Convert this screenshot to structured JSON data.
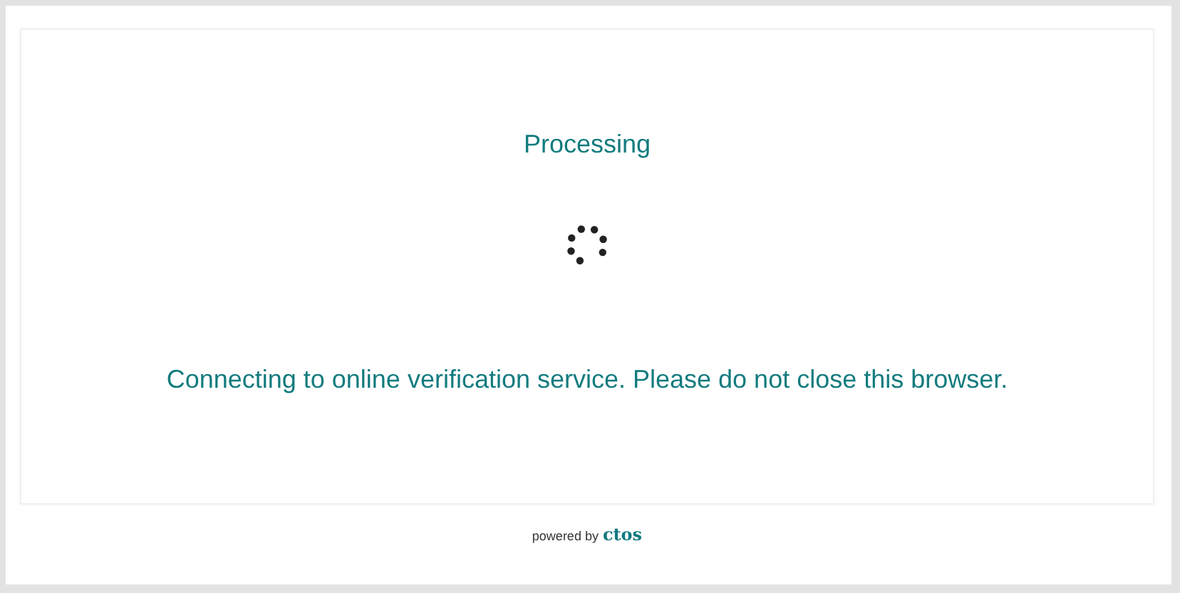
{
  "card": {
    "title": "Processing",
    "message": "Connecting to online verification service. Please do not close this browser."
  },
  "footer": {
    "prefix": "powered by",
    "brand": "ctos"
  }
}
